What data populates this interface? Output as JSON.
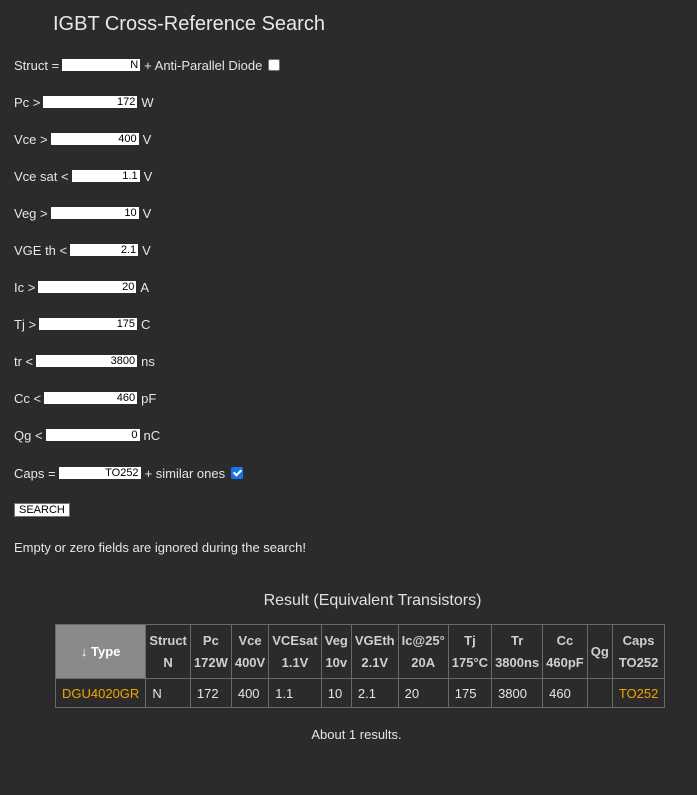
{
  "title": "IGBT Cross-Reference Search",
  "form": {
    "struct": {
      "label": "Struct =",
      "value": "N",
      "suffix": "+ Anti-Parallel Diode",
      "checked": false
    },
    "pc": {
      "label": "Pc >",
      "value": "172",
      "unit": "W"
    },
    "vce": {
      "label": "Vce >",
      "value": "400",
      "unit": "V"
    },
    "vcesat": {
      "label": "Vce sat <",
      "value": "1.1",
      "unit": "V"
    },
    "veg": {
      "label": "Veg >",
      "value": "10",
      "unit": "V"
    },
    "vgeth": {
      "label": "VGE th <",
      "value": "2.1",
      "unit": "V"
    },
    "ic": {
      "label": "Ic >",
      "value": "20",
      "unit": "A"
    },
    "tj": {
      "label": "Tj >",
      "value": "175",
      "unit": "C"
    },
    "tr": {
      "label": "tr <",
      "value": "3800",
      "unit": "ns"
    },
    "cc": {
      "label": "Cc <",
      "value": "460",
      "unit": "pF"
    },
    "qg": {
      "label": "Qg <",
      "value": "0",
      "unit": "nC"
    },
    "caps": {
      "label": "Caps =",
      "value": "TO252",
      "suffix": "+ similar ones",
      "checked": true
    },
    "search_label": "SEARCH",
    "note": "Empty or zero fields are ignored during the search!"
  },
  "result": {
    "title": "Result (Equivalent Transistors)",
    "headers": [
      {
        "l1": "↓ Type",
        "l2": ""
      },
      {
        "l1": "Struct",
        "l2": "N"
      },
      {
        "l1": "Pc",
        "l2": "172W"
      },
      {
        "l1": "Vce",
        "l2": "400V"
      },
      {
        "l1": "VCEsat",
        "l2": "1.1V"
      },
      {
        "l1": "Veg",
        "l2": "10v"
      },
      {
        "l1": "VGEth",
        "l2": "2.1V"
      },
      {
        "l1": "Ic@25°",
        "l2": "20A"
      },
      {
        "l1": "Tj",
        "l2": "175°C"
      },
      {
        "l1": "Tr",
        "l2": "3800ns"
      },
      {
        "l1": "Cc",
        "l2": "460pF"
      },
      {
        "l1": "Qg",
        "l2": ""
      },
      {
        "l1": "Caps",
        "l2": "TO252"
      }
    ],
    "rows": [
      [
        "DGU4020GR",
        "N",
        "172",
        "400",
        "1.1",
        "10",
        "2.1",
        "20",
        "175",
        "3800",
        "460",
        "",
        "TO252"
      ]
    ],
    "about": "About 1 results."
  },
  "colors": {
    "background": "#2b2b2b",
    "link": "#f0a500",
    "sorted_header": "#8a8a8a"
  }
}
